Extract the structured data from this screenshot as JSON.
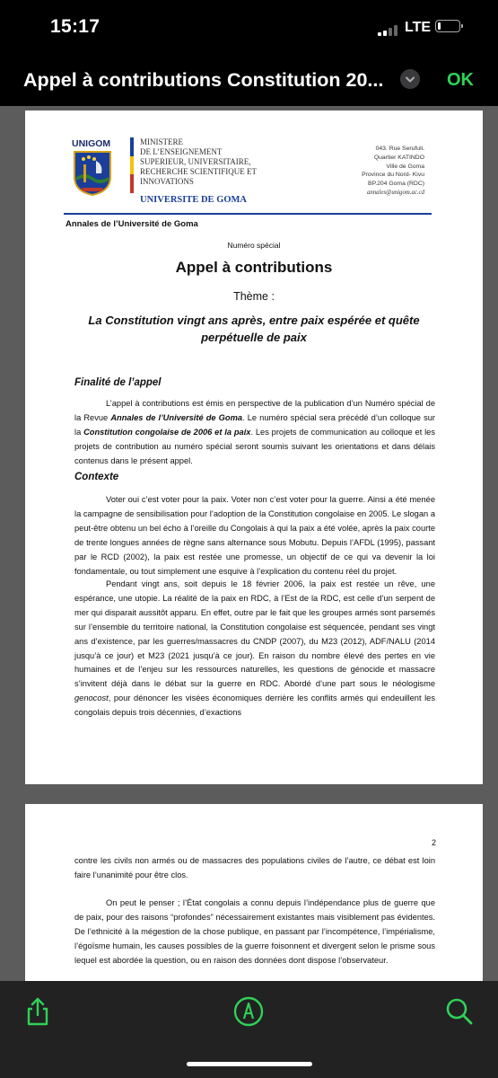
{
  "status": {
    "time": "15:17",
    "network": "LTE",
    "battery_level": 0.15
  },
  "nav": {
    "title": "Appel à contributions Constitution 20...",
    "chevron_icon": "chevron-down-icon",
    "ok_label": "OK",
    "ok_color": "#30d158"
  },
  "page1": {
    "header": {
      "logo_text": "UNIGOM",
      "ministry_lines": [
        "MINISTERE",
        "DE L’ENSEIGNEMENT",
        "SUPERIEUR, UNIVERSITAIRE,",
        "RECHERCHE SCIENTIFIQUE ET",
        "INNOVATIONS"
      ],
      "university": "UNIVERSITE DE GOMA",
      "address_lines": [
        "043. Rue Serufuli.",
        "Quartier KATINDO",
        "Ville de Goma",
        "Province du Nord- Kivu",
        "BP.204 Goma (RDC)"
      ],
      "email": "annales@unigom.ac.cd",
      "journal": "Annales de l’Université de Goma"
    },
    "special": "Numéro spécial",
    "title": "Appel à contributions",
    "theme": "Thème :",
    "subtitle": "La Constitution vingt ans après, entre paix espérée et quête perpétuelle de paix",
    "section1": {
      "heading": "Finalité de l’appel",
      "p1_a": "L’appel à contributions est émis en perspective de la publication d’un Numéro spécial de la Revue ",
      "p1_b": "Annales de l’Université de Goma",
      "p1_c": ". Le numéro spécial sera précédé d’un colloque sur la ",
      "p1_d": "Constitution congolaise de 2006 et la paix",
      "p1_e": ". Les projets de communication au colloque et les projets de contribution au numéro spécial seront soumis suivant les orientations et dans délais contenus dans le présent appel."
    },
    "section2": {
      "heading": "Contexte",
      "p1": "Voter oui c’est voter pour la paix. Voter non c’est voter pour la guerre. Ainsi a été menée la campagne de sensibilisation pour l’adoption de la Constitution congolaise en 2005. Le slogan a peut-être obtenu un bel écho à l’oreille du Congolais à qui la paix a été volée, après la paix courte de trente longues années de règne sans alternance sous Mobutu. Depuis l’AFDL (1995), passant par le RCD (2002), la paix est restée une promesse, un objectif de ce qui va devenir la loi fondamentale, ou tout simplement une esquive à l’explication du contenu réel du projet.",
      "p2_a": "Pendant vingt ans, soit depuis le 18 février 2006, la paix est restée un rêve, une espérance, une utopie. La réalité de la paix en RDC, à l’Est de la RDC, est celle d’un serpent de mer qui disparait aussitôt apparu. En effet, outre par le fait que les groupes armés sont parsemés sur l’ensemble du territoire national, la Constitution congolaise est séquencée, pendant ses vingt ans d’existence, par les guerres/massacres du CNDP (2007), du M23 (2012), ADF/NALU (2014 jusqu’à ce jour) et M23 (2021 jusqu’à ce jour). En raison du nombre élevé des pertes en vie humaines et de l’enjeu sur les ressources naturelles, les questions de génocide et massacre s’invitent déjà dans le débat sur la guerre en RDC. Abordé d’une part sous le néologisme ",
      "p2_b": "genocost",
      "p2_c": ", pour dénoncer les visées économiques derrière les conflits armés qui endeuillent les congolais depuis trois décennies, d’exactions"
    }
  },
  "page2": {
    "page_number": "2",
    "p_cont": "contre les civils non armés ou de massacres des populations civiles de l’autre, ce débat est loin faire l’unanimité pour être clos.",
    "p_next": "On peut le penser ; l’État congolais a connu depuis l’indépendance plus de guerre que de paix, pour des raisons “profondes” nécessairement existantes mais visiblement pas évidentes. De l’ethnicité à la mégestion de la chose publique, en passant par l’incompétence, l’impérialisme, l’égoïsme humain, les causes possibles de la guerre foisonnent et divergent selon le prisme sous lequel est abordée la question, ou en raison des données dont dispose l’observateur."
  },
  "toolbar": {
    "share_icon": "share-icon",
    "markup_icon": "markup-pen-icon",
    "search_icon": "search-icon",
    "accent": "#30d158"
  }
}
